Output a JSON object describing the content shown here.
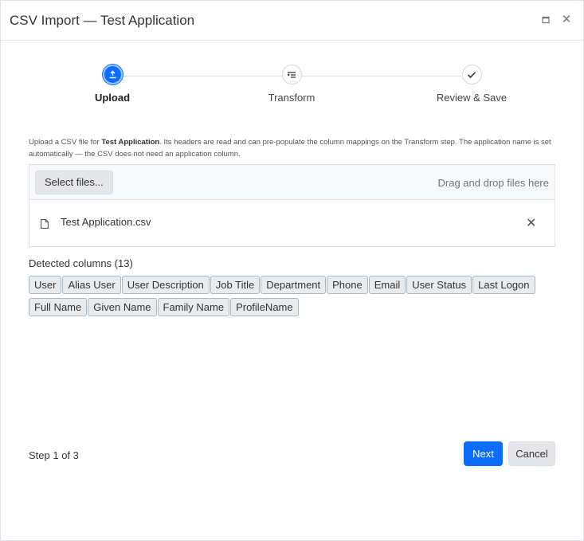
{
  "window": {
    "title": "CSV Import — Test Application",
    "maximize_icon": "maximize-icon",
    "close_icon": "close-icon",
    "maximize_glyph": "▫",
    "close_glyph": "✕"
  },
  "stepper": {
    "steps": [
      {
        "label": "Upload",
        "icon": "upload-icon",
        "active": true
      },
      {
        "label": "Transform",
        "icon": "transform-icon",
        "active": false
      },
      {
        "label": "Review & Save",
        "icon": "checkmark-icon",
        "active": false
      }
    ]
  },
  "description": {
    "prefix": "Upload a CSV file for ",
    "app_name": "Test Application",
    "suffix": ". Its headers are read and can pre-populate the column mappings on the Transform step. The application name is set automatically — the CSV does not need an application column."
  },
  "upload": {
    "select_label": "Select files...",
    "drop_hint": "Drag and drop files here",
    "file_name": "Test Application.csv",
    "remove_glyph": "✕"
  },
  "detected": {
    "label": "Detected columns (13)",
    "columns": [
      "User",
      "Alias User",
      "User Description",
      "Job Title",
      "Department",
      "Phone",
      "Email",
      "User Status",
      "Last Logon",
      "Full Name",
      "Given Name",
      "Family Name",
      "ProfileName"
    ]
  },
  "footer": {
    "step_text": "Step 1 of 3",
    "next_label": "Next",
    "cancel_label": "Cancel"
  },
  "colors": {
    "primary": "#0d6efd",
    "chip_bg": "#e9ecef",
    "secondary_btn": "#e4e6e9"
  }
}
